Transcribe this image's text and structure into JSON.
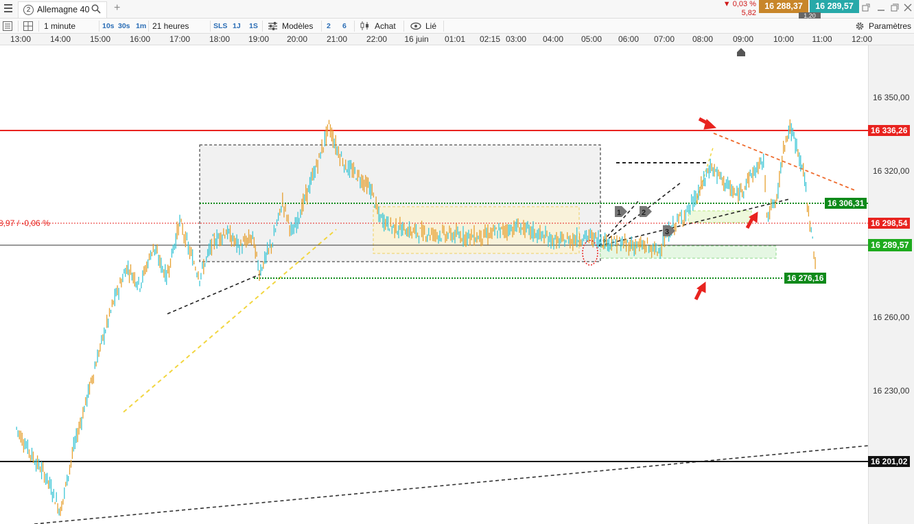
{
  "window": {
    "tab_number": "2",
    "tab_title": "Allemagne 40",
    "change_percent": "▼ 0,03 %",
    "change_points": "5,82",
    "bid_price": "16 288,37",
    "ask_price": "16 289,57",
    "spread": "1,20"
  },
  "toolbar": {
    "interval": "1 minute",
    "interval_10s": "10s",
    "interval_30s": "30s",
    "interval_1m": "1m",
    "period": "21 heures",
    "period_sls": "SLS",
    "period_1j": "1J",
    "period_1s": "1S",
    "models_label": "Modèles",
    "layout_2": "2",
    "layout_6": "6",
    "buy_label": "Achat",
    "linked_label": "Lié",
    "settings_label": "Paramètres"
  },
  "time_axis": [
    "13:00",
    "14:00",
    "15:00",
    "16:00",
    "17:00",
    "18:00",
    "19:00",
    "20:00",
    "21:00",
    "22:00",
    "16 juin",
    "01:01",
    "02:15",
    "03:00",
    "04:00",
    "05:00",
    "06:00",
    "07:00",
    "08:00",
    "09:00",
    "10:00",
    "11:00",
    "12:00"
  ],
  "price_axis": [
    "16 350,00",
    "16 320,00",
    "16 260,00",
    "16 230,00"
  ],
  "price_tags": {
    "resistance": "16 336,26",
    "green_upper": "16 306,31",
    "previous_close": "16 298,54",
    "current": "16 289,57",
    "green_lower": "16 276,16",
    "support": "16 201,02"
  },
  "previous_close_label": "8,97 / -0,06 %",
  "drawing_markers": [
    "1",
    "2",
    "3"
  ],
  "colors": {
    "resistance": "#e8231f",
    "green": "#0f8a1a",
    "bid": "#c8862a",
    "ask": "#27a9a9",
    "candle_up": "#3cc6d6",
    "candle_down": "#e6a030"
  },
  "chart_data": {
    "type": "line",
    "xlim": [
      "13:00",
      "12:00"
    ],
    "ylim": [
      16180,
      16370
    ],
    "x": [
      "12:54",
      "13:15",
      "13:40",
      "14:00",
      "14:20",
      "14:40",
      "15:00",
      "15:20",
      "15:40",
      "16:00",
      "16:20",
      "16:40",
      "17:00",
      "17:15",
      "17:30",
      "17:50",
      "18:10",
      "18:30",
      "18:50",
      "19:00",
      "19:20",
      "19:35",
      "19:50",
      "20:10",
      "20:30",
      "20:45",
      "20:55",
      "21:10",
      "21:30",
      "21:50",
      "22:00",
      "22:20",
      "22:50",
      "23:30",
      "00:30",
      "01:30",
      "02:30",
      "03:15",
      "03:45",
      "04:15",
      "04:45",
      "05:00",
      "05:15",
      "05:30",
      "05:45",
      "06:00",
      "06:20",
      "06:40",
      "07:00",
      "07:20",
      "07:40",
      "07:45",
      "08:00",
      "08:10",
      "08:20",
      "08:30",
      "08:40",
      "08:50",
      "09:00"
    ],
    "series": [
      {
        "values": [
          16218,
          16208,
          16198,
          16185,
          16210,
          16230,
          16250,
          16268,
          16282,
          16275,
          16290,
          16278,
          16300,
          16288,
          16278,
          16292,
          16296,
          16290,
          16294,
          16280,
          16292,
          16308,
          16295,
          16310,
          16325,
          16338,
          16330,
          16322,
          16318,
          16312,
          16302,
          16298,
          16296,
          16295,
          16294,
          16298,
          16292,
          16294,
          16292,
          16291,
          16290,
          16288,
          16295,
          16300,
          16304,
          16310,
          16322,
          16316,
          16310,
          16318,
          16324,
          16304,
          16308,
          16330,
          16337,
          16330,
          16320,
          16300,
          16280
        ]
      }
    ],
    "levels": [
      16336.26,
      16306.31,
      16298.54,
      16289.57,
      16276.16,
      16201.02
    ]
  }
}
